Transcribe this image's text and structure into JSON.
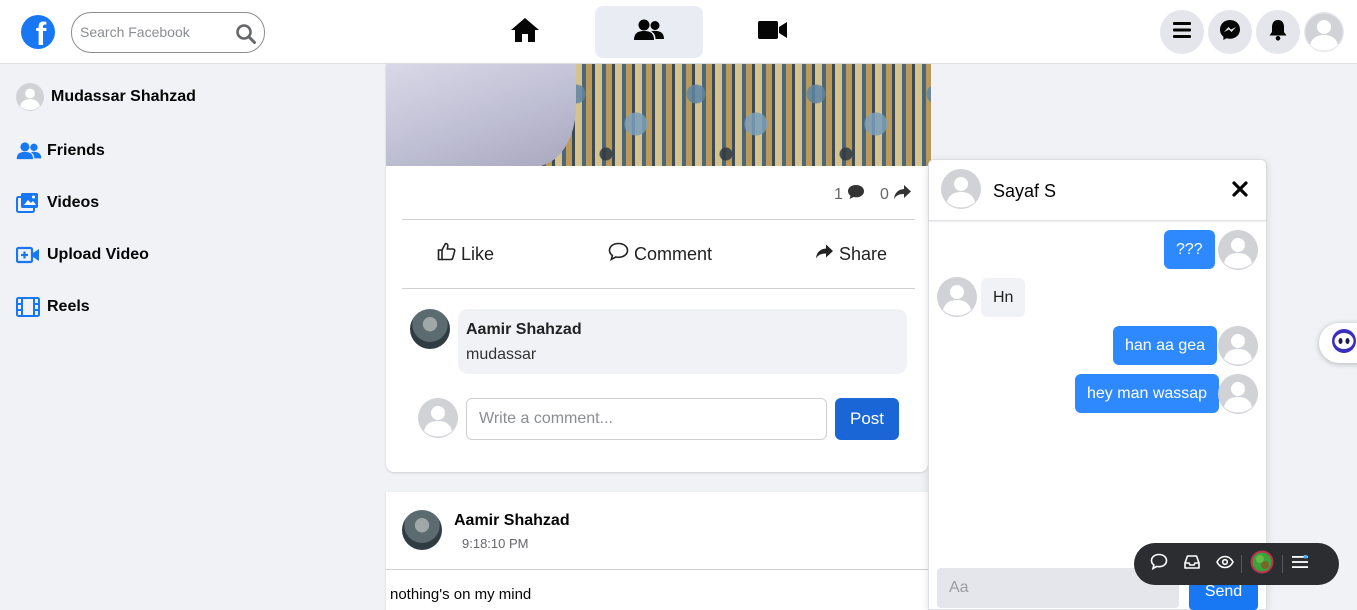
{
  "header": {
    "logo_letter": "f",
    "search_placeholder": "Search Facebook",
    "nav_tabs": [
      "home",
      "friends",
      "videos"
    ],
    "active_tab": "friends",
    "accent_color": "#1877f2"
  },
  "sidebar": {
    "profile_name": "Mudassar Shahzad",
    "items": [
      {
        "label": "Friends",
        "icon": "friends-icon"
      },
      {
        "label": "Videos",
        "icon": "videos-icon"
      },
      {
        "label": "Upload Video",
        "icon": "upload-video-icon"
      },
      {
        "label": "Reels",
        "icon": "reels-icon"
      }
    ]
  },
  "post": {
    "comment_count": "1",
    "share_count": "0",
    "actions": {
      "like": "Like",
      "comment": "Comment",
      "share": "Share"
    },
    "comment": {
      "author": "Aamir Shahzad",
      "text": "mudassar"
    },
    "comment_placeholder": "Write a comment...",
    "post_button": "Post"
  },
  "post2": {
    "author": "Aamir Shahzad",
    "time": "9:18:10 PM",
    "text": "nothing's on my mind"
  },
  "chat": {
    "contact_name": "Sayaf S",
    "messages": [
      {
        "direction": "out",
        "text": "???"
      },
      {
        "direction": "in",
        "text": "Hn"
      },
      {
        "direction": "out",
        "text": "han aa gea"
      },
      {
        "direction": "out",
        "text": "hey man wassap"
      }
    ],
    "input_placeholder": "Aa",
    "send_button": "Send",
    "outgoing_color": "#2e89ff"
  },
  "floating_toolbar": {
    "items": [
      "chat-bubble-icon",
      "inbox-icon",
      "eye-icon",
      "color-orb-icon",
      "menu-icon"
    ]
  }
}
